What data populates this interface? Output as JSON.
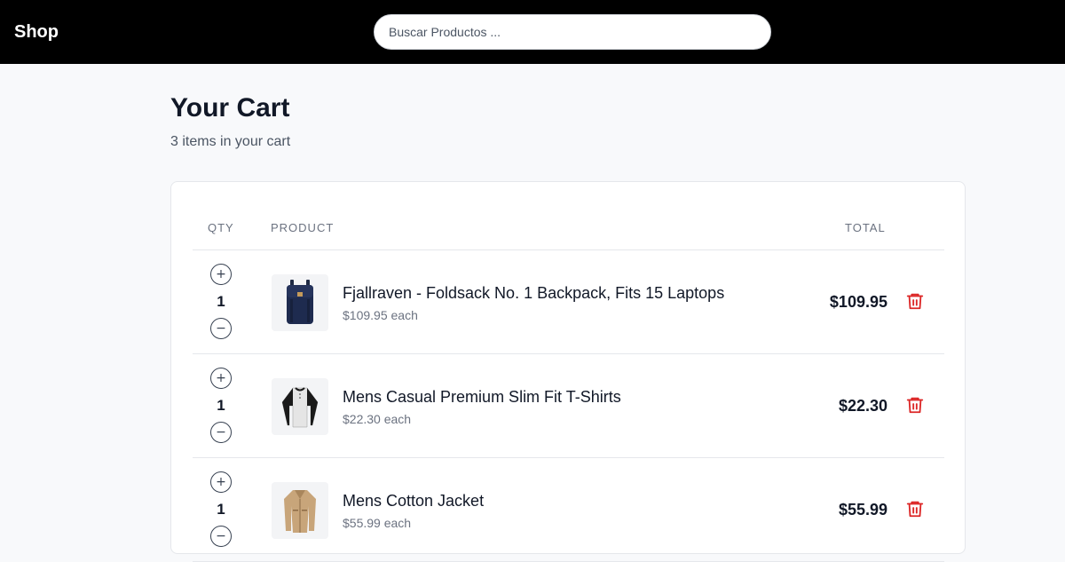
{
  "header": {
    "brand": "Shop",
    "search_placeholder": "Buscar Productos ..."
  },
  "cart": {
    "title": "Your Cart",
    "subtitle": "3 items in your cart",
    "columns": {
      "qty": "QTY",
      "product": "PRODUCT",
      "total": "TOTAL"
    },
    "items": [
      {
        "qty": "1",
        "name": "Fjallraven - Foldsack No. 1 Backpack, Fits 15 Laptops",
        "each": "$109.95 each",
        "total": "$109.95",
        "image": "backpack"
      },
      {
        "qty": "1",
        "name": "Mens Casual Premium Slim Fit T-Shirts",
        "each": "$22.30 each",
        "total": "$22.30",
        "image": "raglan-tshirt"
      },
      {
        "qty": "1",
        "name": "Mens Cotton Jacket",
        "each": "$55.99 each",
        "total": "$55.99",
        "image": "jacket"
      }
    ]
  },
  "icons": {
    "plus": "+",
    "minus": "−",
    "delete": "trash-icon"
  },
  "colors": {
    "header_bg": "#000000",
    "delete_red": "#dc2626"
  }
}
